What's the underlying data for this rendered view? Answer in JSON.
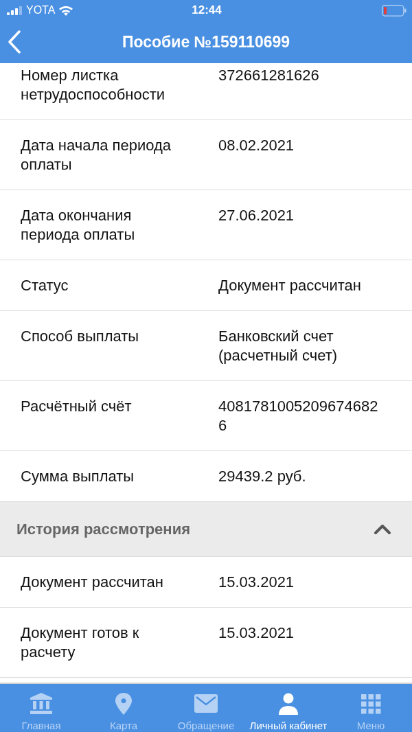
{
  "status_bar": {
    "carrier": "YOTA",
    "time": "12:44"
  },
  "nav_bar": {
    "title": "Пособие №159110699"
  },
  "details": [
    {
      "label": "Номер листка нетрудоспособности",
      "value": "372661281626"
    },
    {
      "label": "Дата начала периода оплаты",
      "value": "08.02.2021"
    },
    {
      "label": "Дата окончания периода оплаты",
      "value": "27.06.2021"
    },
    {
      "label": "Статус",
      "value": "Документ рассчитан"
    },
    {
      "label": "Способ выплаты",
      "value": "Банковский счет (расчетный счет)"
    },
    {
      "label": "Расчётный счёт",
      "value": "40817810052096746826"
    },
    {
      "label": "Сумма выплаты",
      "value": "29439.2 руб."
    }
  ],
  "history": {
    "title": "История рассмотрения",
    "expanded": true,
    "rows": [
      {
        "label": "Документ рассчитан",
        "value": "15.03.2021"
      },
      {
        "label": "Документ готов к расчету",
        "value": "15.03.2021"
      }
    ]
  },
  "tab_bar": [
    {
      "kind": "home",
      "label": "Главная",
      "selected": false
    },
    {
      "kind": "map",
      "label": "Карта",
      "selected": false
    },
    {
      "kind": "message",
      "label": "Обращение",
      "selected": false
    },
    {
      "kind": "profile",
      "label": "Личный кабинет",
      "selected": true
    },
    {
      "kind": "menu",
      "label": "Меню",
      "selected": false
    }
  ]
}
